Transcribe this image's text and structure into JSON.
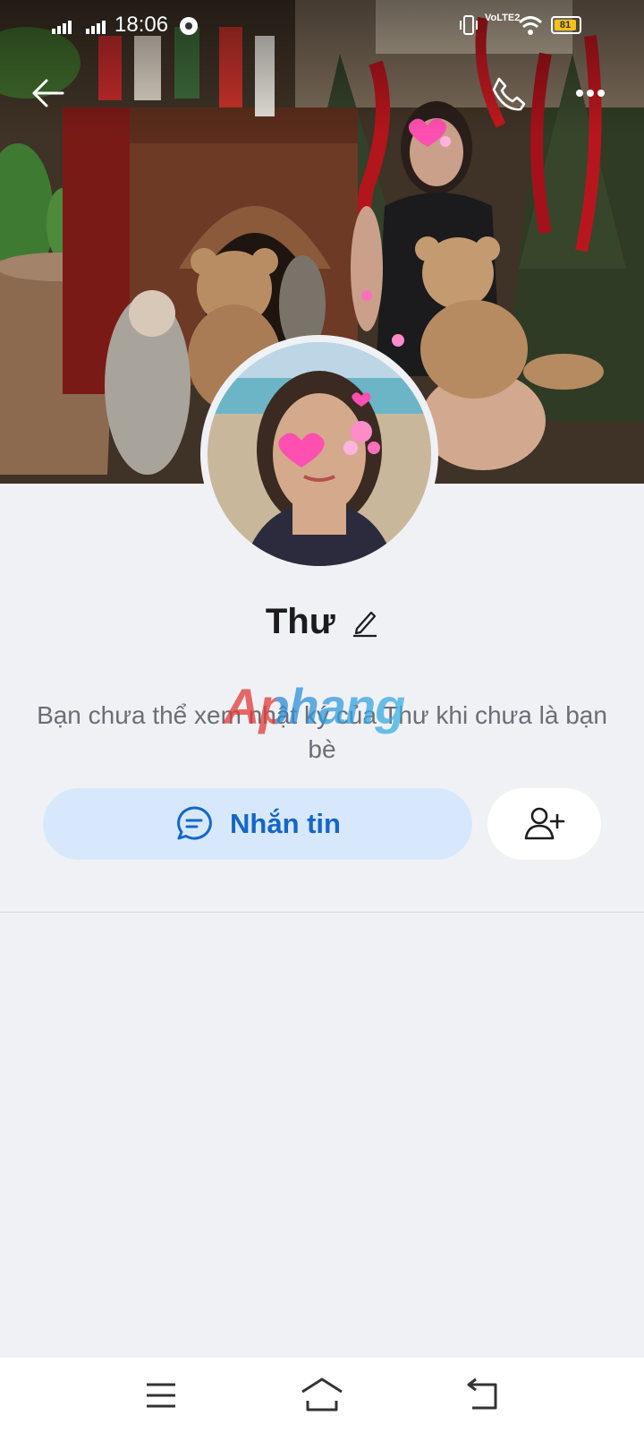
{
  "status_bar": {
    "time": "18:06",
    "volte_label": "VoLTE2",
    "battery_level": "81",
    "icons": [
      "signal-icon",
      "signal-icon",
      "chrome-icon",
      "vibrate-icon",
      "volte-icon",
      "wifi-icon",
      "battery-icon"
    ]
  },
  "header": {
    "back_icon": "arrow-left-icon",
    "call_icon": "phone-icon",
    "more_icon": "more-horizontal-icon"
  },
  "profile": {
    "name": "Thư",
    "edit_icon": "pencil-icon",
    "notice": "Bạn chưa thể xem nhật ký của Thư khi chưa là bạn bè",
    "watermark": "Aphang"
  },
  "actions": {
    "message_label": "Nhắn tin",
    "message_icon": "chat-bubble-icon",
    "add_friend_icon": "add-user-icon"
  },
  "system_nav": {
    "icons": [
      "menu-icon",
      "home-icon",
      "back-icon"
    ]
  },
  "colors": {
    "background": "#f0f1f5",
    "message_button_bg": "#d8e8fc",
    "accent_blue": "#1467c8",
    "name_text": "#1c1c1e",
    "notice_text": "#6b6e75"
  }
}
